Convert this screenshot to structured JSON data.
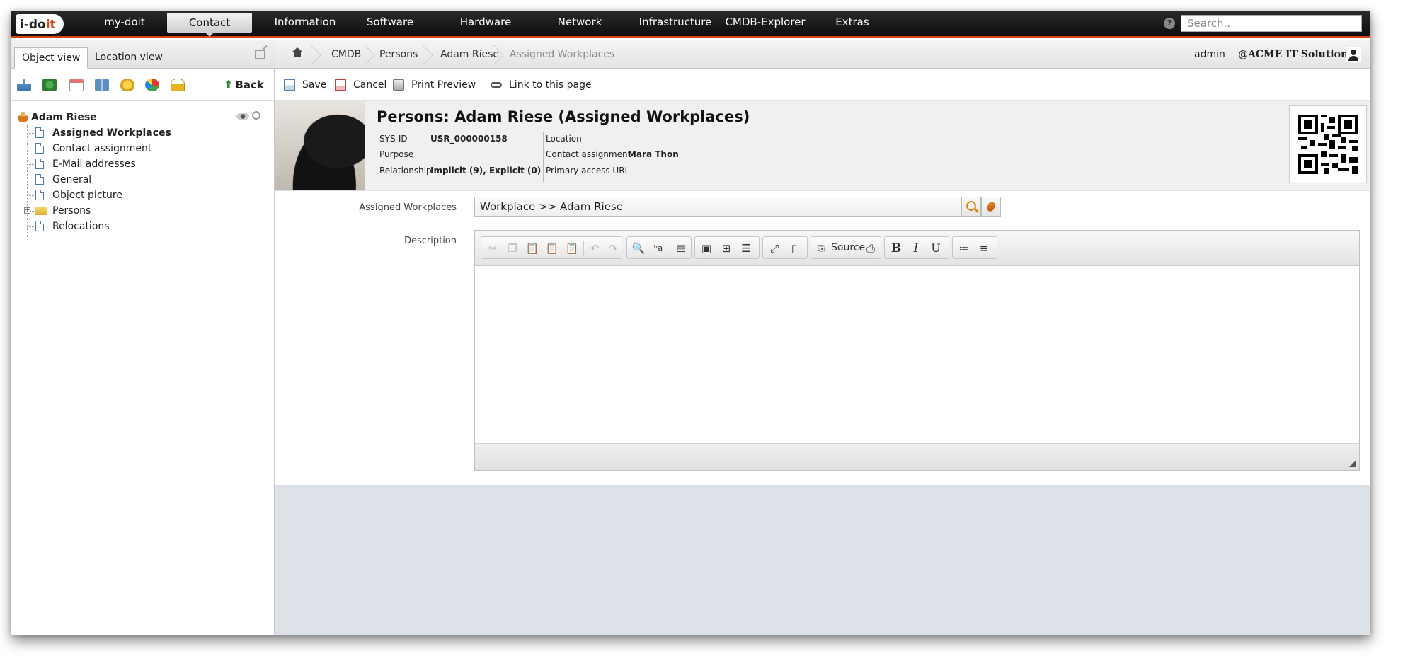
{
  "app": {
    "logo_main": "i-do",
    "logo_accent": "it"
  },
  "topnav": {
    "items": [
      {
        "label": "my-doit"
      },
      {
        "label": "Contact"
      },
      {
        "label": "Information"
      },
      {
        "label": "Software"
      },
      {
        "label": "Hardware"
      },
      {
        "label": "Network"
      },
      {
        "label": "Infrastructure"
      },
      {
        "label": "CMDB-Explorer"
      },
      {
        "label": "Extras"
      }
    ],
    "active": "Contact",
    "help_label": "?",
    "search_placeholder": "Search.."
  },
  "leftpanel": {
    "tabs": [
      {
        "label": "Object view",
        "active": true
      },
      {
        "label": "Location view",
        "active": false
      }
    ],
    "toolbar_icons": [
      "tree-structure-icon",
      "expand-icon",
      "calendar-icon",
      "book-icon",
      "badge-icon",
      "chart-icon",
      "lock-icon"
    ],
    "back_label": "Back",
    "tree": {
      "root": "Adam Riese",
      "nodes": [
        {
          "label": "Assigned Workplaces",
          "active": true,
          "type": "doc"
        },
        {
          "label": "Contact assignment",
          "active": false,
          "type": "doc"
        },
        {
          "label": "E-Mail addresses",
          "active": false,
          "type": "doc"
        },
        {
          "label": "General",
          "active": false,
          "type": "doc"
        },
        {
          "label": "Object picture",
          "active": false,
          "type": "doc"
        },
        {
          "label": "Persons",
          "active": false,
          "type": "folder"
        },
        {
          "label": "Relocations",
          "active": false,
          "type": "doc"
        }
      ]
    }
  },
  "breadcrumb": {
    "items": [
      "CMDB",
      "Persons",
      "Adam Riese",
      "Assigned Workplaces"
    ]
  },
  "user": {
    "name": "admin",
    "org": "@ACME IT Solutions"
  },
  "actions": {
    "save": "Save",
    "cancel": "Cancel",
    "print_preview": "Print Preview",
    "link": "Link to this page"
  },
  "object": {
    "title": "Persons: Adam Riese (Assigned Workplaces)",
    "sysid_label": "SYS-ID",
    "sysid_value": "USR_000000158",
    "purpose_label": "Purpose",
    "purpose_value": "",
    "relationship_label": "Relationship",
    "relationship_value": "Implicit (9), Explicit (0)",
    "location_label": "Location",
    "location_value": "",
    "contact_label": "Contact assignment",
    "contact_value": "Mara Thon",
    "access_label": "Primary access URL",
    "access_value": "-"
  },
  "form": {
    "workplaces_label": "Assigned Workplaces",
    "workplaces_value": "Workplace >> Adam Riese",
    "description_label": "Description",
    "source_label": "Source"
  },
  "colors": {
    "accent": "#d84315",
    "topbar": "#1a1a1a",
    "main_bg": "#dde2e8"
  }
}
